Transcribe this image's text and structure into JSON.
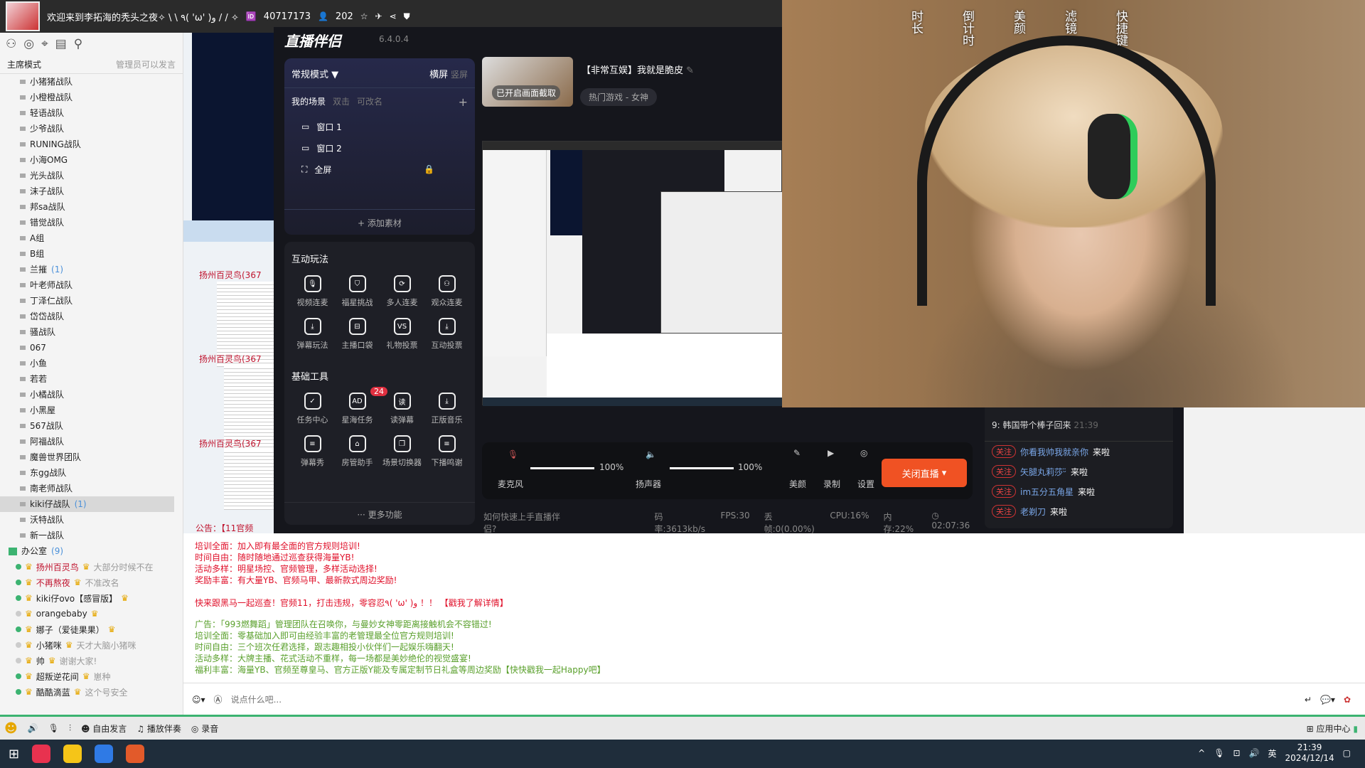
{
  "topbar": {
    "title": "欢迎来到李拓海的秃头之夜✧ \\ \\ ٩( 'ω' )و / / ✧",
    "room_id": "40717173",
    "viewers": "202"
  },
  "sidebar": {
    "mode": "主席模式",
    "mode_hint": "管理员可以发言",
    "channels": [
      {
        "name": "小猪猪战队"
      },
      {
        "name": "小橙橙战队"
      },
      {
        "name": "轻语战队"
      },
      {
        "name": "少爷战队"
      },
      {
        "name": "RUNING战队"
      },
      {
        "name": "小海OMG"
      },
      {
        "name": "光头战队"
      },
      {
        "name": "沫子战队"
      },
      {
        "name": "邦sa战队"
      },
      {
        "name": "错觉战队"
      },
      {
        "name": "A组"
      },
      {
        "name": "B组"
      },
      {
        "name": "兰摧",
        "count": "(1)"
      },
      {
        "name": "叶老师战队"
      },
      {
        "name": "丁泽仁战队"
      },
      {
        "name": "岱岱战队"
      },
      {
        "name": "骚战队"
      },
      {
        "name": "067"
      },
      {
        "name": "小鱼"
      },
      {
        "name": "若若"
      },
      {
        "name": "小橘战队"
      },
      {
        "name": "小黑屋"
      },
      {
        "name": "567战队"
      },
      {
        "name": "阿福战队"
      },
      {
        "name": "魔兽世界团队"
      },
      {
        "name": "东gg战队"
      },
      {
        "name": "南老师战队"
      },
      {
        "name": "kiki仔战队",
        "count": "(1)"
      },
      {
        "name": "沃特战队"
      },
      {
        "name": "新一战队"
      }
    ],
    "office": {
      "name": "办公室",
      "count": "(9)"
    },
    "users": [
      {
        "name": "扬州百灵鸟",
        "sig": "大部分时候不在"
      },
      {
        "name": "不再熬夜",
        "sig": "不准改名"
      },
      {
        "name": "kiki仔ovo【感冒版】",
        "sig": ""
      },
      {
        "name": "orangebaby",
        "sig": ""
      },
      {
        "name": "娜子（爱徒果果）",
        "sig": ""
      },
      {
        "name": "小猪咪",
        "sig": "天才大脑小猪咪"
      },
      {
        "name": "帅",
        "sig": "谢谢大家!"
      },
      {
        "name": "超叛逆花间",
        "sig": "崽种"
      },
      {
        "name": "酷酷滴蓝",
        "sig": "这个号安全"
      }
    ]
  },
  "feed": {
    "poster": "扬州百灵鸟(367",
    "notice": "公告：【11官频"
  },
  "companion": {
    "logo": "直播伴侣",
    "version": "6.4.0.4",
    "mode": "常规模式 ▼",
    "landscape": "横屏",
    "portrait": "竖屏",
    "my_scenes": "我的场景",
    "hint1": "双击",
    "hint2": "可改名",
    "scenes": [
      "窗口 1",
      "窗口 2",
      "全屏"
    ],
    "add_material": "添加素材",
    "interactive_title": "互动玩法",
    "interactive": [
      "视频连麦",
      "福星挑战",
      "多人连麦",
      "观众连麦",
      "弹幕玩法",
      "主播口袋",
      "礼物投票",
      "互动投票"
    ],
    "basic_title": "基础工具",
    "basic": [
      "任务中心",
      "星海任务",
      "读弹幕",
      "正版音乐",
      "弹幕秀",
      "房管助手",
      "场景切换器",
      "下播鸣谢"
    ],
    "badge": "24",
    "more": "更多功能",
    "thumb_text": "已开启画面截取",
    "room_title": "【非常互娱】我就是脆皮",
    "category": "热门游戏 - 女神",
    "mic_label": "麦克风",
    "mic_level": "100%",
    "speaker_label": "扬声器",
    "speaker_level": "100%",
    "beauty": "美颜",
    "record": "录制",
    "settings": "设置",
    "end_live": "关闭直播",
    "help": "如何快速上手直播伴侣?",
    "bitrate": "码率:3613kb/s",
    "fps": "FPS:30",
    "dropped": "丢帧:0(0.00%)",
    "cpu": "CPU:16%",
    "memory": "内存:22%",
    "duration": "02:07:36"
  },
  "danmu": {
    "top_line": "9: 韩国带个棒子回来",
    "top_time": "21:39",
    "follow": "关注",
    "arrive": "来啦",
    "users": [
      "你看我帅我就亲你",
      "矢腿丸莉莎ᵕ̈",
      "im五分五角星",
      "老剃刀"
    ]
  },
  "camera_overlay": [
    "时长",
    "倒计时",
    "美颜",
    "滤镜",
    "快捷键"
  ],
  "chat": {
    "red": [
      "培训全面：加入即有最全面的官方规则培训!",
      "时间自由：随时随地通过巡查获得海量YB!",
      "活动多样：明星场控、官频管理，多样活动选择!",
      "奖励丰富：有大量YB、官频马甲、最新款式周边奖励!",
      "",
      "快来跟黑马一起巡查！官频11，打击违规，零容忍٩( 'ω' )و ！！ 【戳我了解详情】"
    ],
    "green": [
      "广告：「993燃舞蹈」管理团队在召唤你，与曼妙女神零距离接触机会不容错过!",
      "培训全面：零基础加入即可由经验丰富的老管理最全位官方规则培训!",
      "时间自由：三个班次任君选择，跟志趣相投小伙伴们一起娱乐嗨翻天!",
      "活动多样：大牌主播、花式活动不重样，每一场都是美妙绝伦的视觉盛宴!",
      "福利丰富：海量YB、官频至尊皇马、官方正版Y能及专属定制节日礼盒等周边奖励【快快戳我一起Happy吧】"
    ]
  },
  "input": {
    "placeholder": "说点什么吧..."
  },
  "toolbar": {
    "free_speech": "自由发言",
    "playlist": "播放伴奏",
    "recording": "录音",
    "app_center": "应用中心"
  },
  "taskbar": {
    "time": "21:39",
    "date": "2024/12/14",
    "ime": "英"
  },
  "colors": {
    "accent": "#f05223",
    "online": "#3cb371",
    "notice_red": "#e0102a",
    "ad_green": "#5aa02c"
  }
}
